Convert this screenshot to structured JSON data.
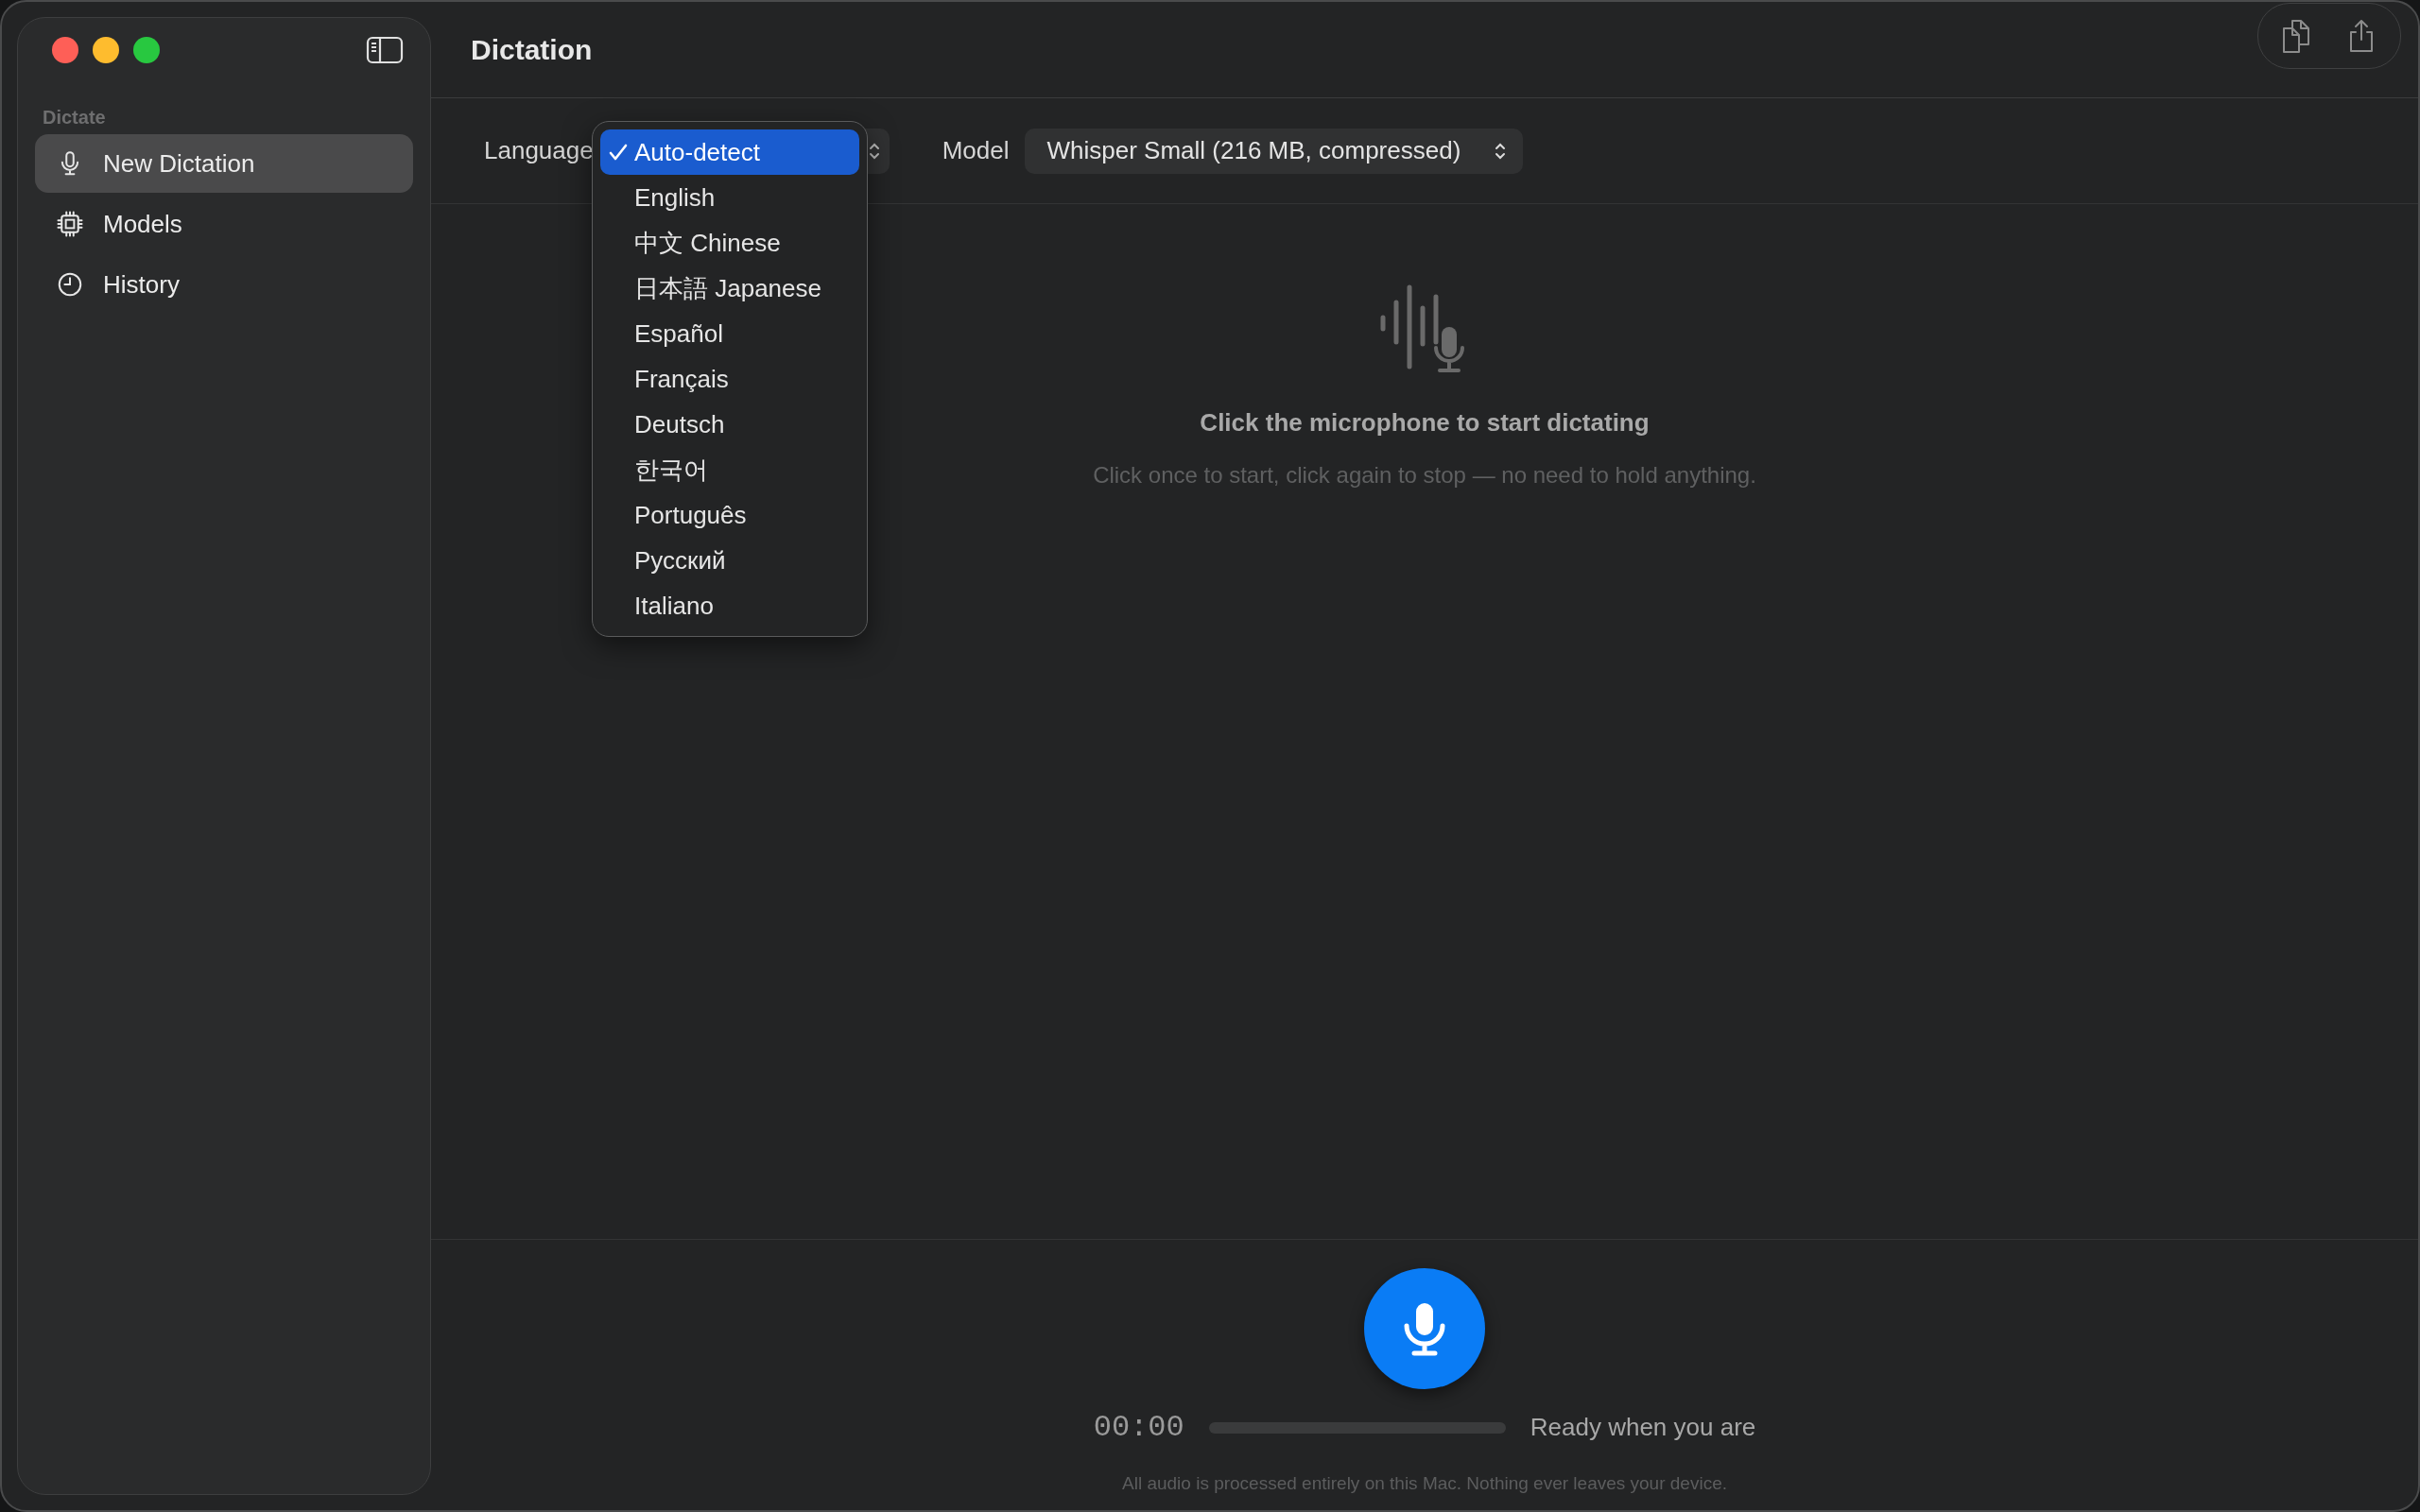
{
  "window": {
    "title": "Dictation"
  },
  "sidebar": {
    "section": "Dictate",
    "items": [
      {
        "label": "New Dictation",
        "kind": "mic",
        "selected": true
      },
      {
        "label": "Models",
        "kind": "chip",
        "selected": false
      },
      {
        "label": "History",
        "kind": "clock",
        "selected": false
      }
    ]
  },
  "toolbar": {
    "language_label": "Language",
    "model_label": "Model",
    "model_value": "Whisper Small (216 MB, compressed)"
  },
  "language_menu": {
    "items": [
      {
        "label": "Auto-detect",
        "selected": true
      },
      {
        "label": "English",
        "selected": false
      },
      {
        "label": "中文 Chinese",
        "selected": false
      },
      {
        "label": "日本語 Japanese",
        "selected": false
      },
      {
        "label": "Español",
        "selected": false
      },
      {
        "label": "Français",
        "selected": false
      },
      {
        "label": "Deutsch",
        "selected": false
      },
      {
        "label": "한국어",
        "selected": false
      },
      {
        "label": "Português",
        "selected": false
      },
      {
        "label": "Русский",
        "selected": false
      },
      {
        "label": "Italiano",
        "selected": false
      }
    ]
  },
  "empty_state": {
    "heading": "Click the microphone to start dictating",
    "hint": "Click once to start, click again to stop — no need to hold anything."
  },
  "recorder": {
    "time": "00:00",
    "level": 0,
    "status": "Ready when you are",
    "footer": "All audio is processed entirely on this Mac. Nothing ever leaves your device."
  }
}
